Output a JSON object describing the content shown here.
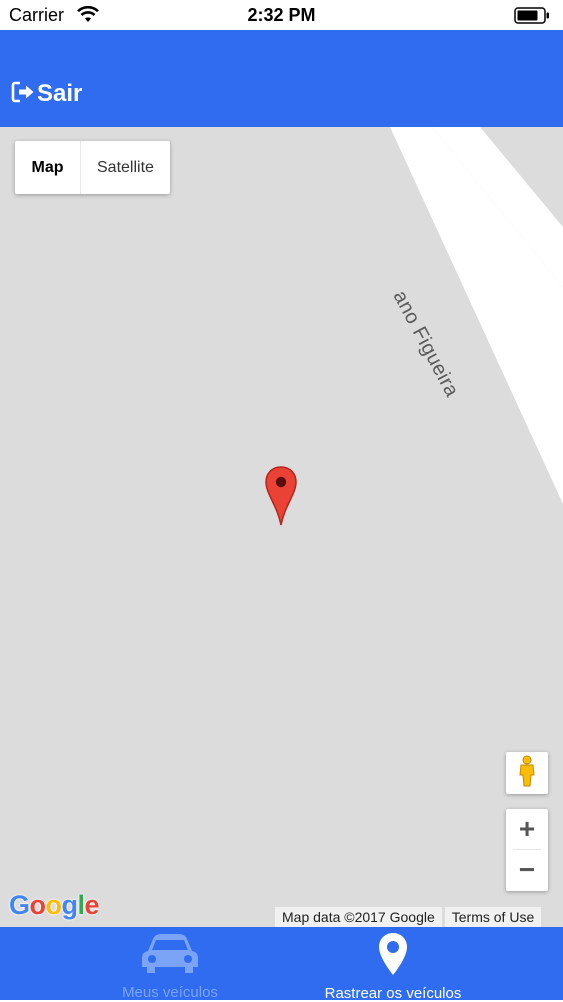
{
  "status_bar": {
    "carrier": "Carrier",
    "time": "2:32 PM"
  },
  "header": {
    "logout_label": "Sair",
    "logout_icon": "sign-out-icon"
  },
  "map": {
    "street_label": "ano Figueira",
    "map_types": [
      {
        "label": "Map",
        "selected": true
      },
      {
        "label": "Satellite",
        "selected": false
      }
    ],
    "zoom_in": "+",
    "zoom_out": "−",
    "logo": [
      "G",
      "o",
      "o",
      "g",
      "l",
      "e"
    ],
    "attribution": "Map data ©2017 Google",
    "terms": "Terms of Use"
  },
  "tabs": [
    {
      "label": "Meus veículos",
      "icon": "car-icon",
      "active": false
    },
    {
      "label": "Rastrear os veículos",
      "icon": "map-marker-icon",
      "active": true
    }
  ],
  "colors": {
    "brand": "#2f6cf0",
    "inactive_tab": "#7ba3f6",
    "map_bg": "#dcdcdc",
    "marker": "#ea4335"
  }
}
